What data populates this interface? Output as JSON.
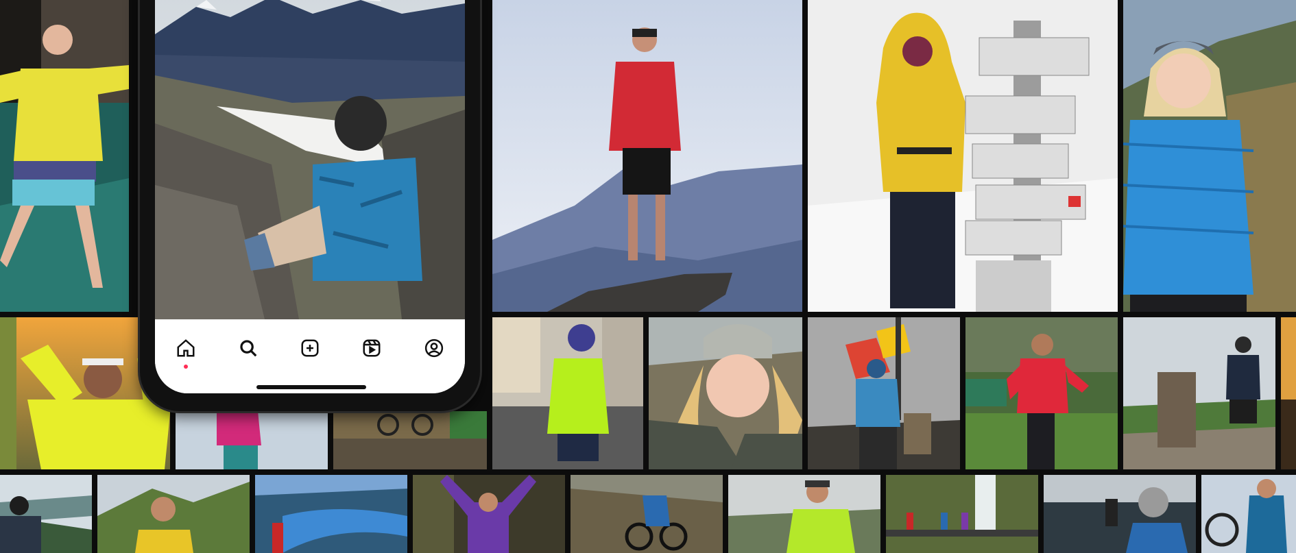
{
  "mosaic": {
    "tiles": [
      {
        "name": "photo-man-yellow-jacket-cave",
        "icon": "photo"
      },
      {
        "name": "photo-hiker-red-jacket-peak",
        "icon": "photo"
      },
      {
        "name": "photo-hiker-yellow-jacket-snow-signpost",
        "icon": "photo"
      },
      {
        "name": "photo-woman-blue-puffer-smiling",
        "icon": "photo"
      },
      {
        "name": "photo-woman-yellow-jacket-sunset",
        "icon": "photo"
      },
      {
        "name": "photo-cyclist-green-jacket-street",
        "icon": "photo"
      },
      {
        "name": "photo-woman-beanie-selfie",
        "icon": "photo"
      },
      {
        "name": "photo-hiker-flag-summit",
        "icon": "photo"
      },
      {
        "name": "photo-woman-red-jacket-field",
        "icon": "photo"
      },
      {
        "name": "photo-hiker-cairn",
        "icon": "photo"
      },
      {
        "name": "photo-man-lakeside",
        "icon": "photo"
      },
      {
        "name": "photo-woman-mountain-valley",
        "icon": "photo"
      },
      {
        "name": "photo-fjord-red-jacket",
        "icon": "photo"
      },
      {
        "name": "photo-woman-purple-jacket-forest",
        "icon": "photo"
      },
      {
        "name": "photo-mountain-biker",
        "icon": "photo"
      },
      {
        "name": "photo-man-green-jacket-cap",
        "icon": "photo"
      },
      {
        "name": "photo-waterfall-bridge",
        "icon": "photo"
      },
      {
        "name": "photo-woman-coast-beanie",
        "icon": "photo"
      },
      {
        "name": "photo-cyclist-blue-bike",
        "icon": "photo"
      }
    ]
  },
  "phone": {
    "tabs": [
      {
        "name": "home",
        "icon": "home-icon",
        "active": true
      },
      {
        "name": "search",
        "icon": "search-icon",
        "active": false
      },
      {
        "name": "create",
        "icon": "plus-square-icon",
        "active": false
      },
      {
        "name": "reels",
        "icon": "reels-icon",
        "active": false
      },
      {
        "name": "profile",
        "icon": "profile-icon",
        "active": false
      }
    ],
    "accent": "#ff2d55"
  }
}
